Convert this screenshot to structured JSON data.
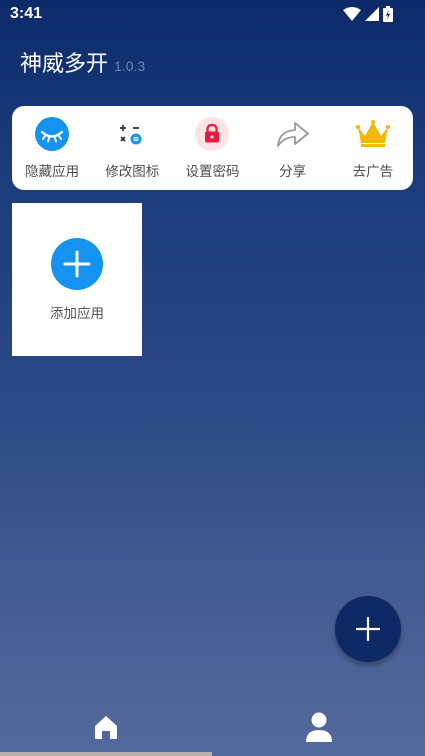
{
  "status_bar": {
    "time": "3:41"
  },
  "header": {
    "title": "神威多开",
    "version": "1.0.3"
  },
  "toolbar": {
    "items": [
      {
        "label": "隐藏应用",
        "icon": "eye-closed-icon"
      },
      {
        "label": "修改图标",
        "icon": "calculator-icon"
      },
      {
        "label": "设置密码",
        "icon": "lock-icon"
      },
      {
        "label": "分享",
        "icon": "share-arrow-icon"
      },
      {
        "label": "去广告",
        "icon": "crown-icon"
      }
    ]
  },
  "apps": {
    "add_label": "添加应用"
  },
  "colors": {
    "accent_blue": "#1593f0",
    "fab": "#0d2a66",
    "lock_red": "#e8193c",
    "crown_gold": "#f5b800"
  },
  "bottom_nav": {
    "items": [
      {
        "icon": "home-icon",
        "selected": true
      },
      {
        "icon": "profile-icon",
        "selected": false
      }
    ]
  }
}
